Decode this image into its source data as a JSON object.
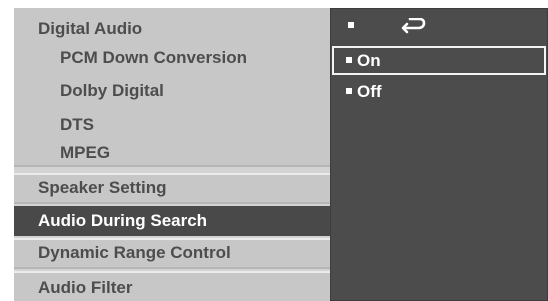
{
  "menu": {
    "items": [
      {
        "label": "Digital Audio",
        "type": "header"
      },
      {
        "label": "PCM Down Conversion",
        "type": "sub"
      },
      {
        "label": "Dolby Digital",
        "type": "sub"
      },
      {
        "label": "DTS",
        "type": "sub"
      },
      {
        "label": "MPEG",
        "type": "sub"
      },
      {
        "label": "Speaker Setting",
        "type": "header"
      },
      {
        "label": "Audio  During Search",
        "type": "header",
        "selected": true
      },
      {
        "label": "Dynamic Range Control",
        "type": "header"
      },
      {
        "label": "Audio  Filter",
        "type": "header"
      }
    ]
  },
  "submenu": {
    "top_icon": "return-icon",
    "options": [
      {
        "label": "On",
        "selected": true
      },
      {
        "label": "Off",
        "selected": false
      }
    ]
  },
  "colors": {
    "left_bg": "#d3d3d3",
    "group_bg": "#c7c7c7",
    "selected_bg": "#494949",
    "right_bg": "#4c4c4c",
    "text_dark": "#4d4d4d",
    "text_light": "#ffffff"
  }
}
